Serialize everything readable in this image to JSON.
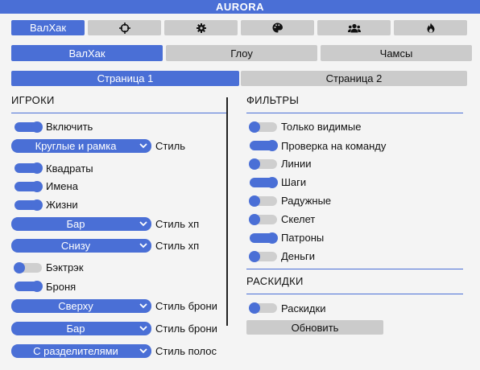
{
  "window": {
    "title": "AURORA"
  },
  "top_tabs": [
    {
      "label": "ВалХак",
      "active": true
    },
    {
      "icon": "crosshair-icon"
    },
    {
      "icon": "gear-icon"
    },
    {
      "icon": "palette-icon"
    },
    {
      "icon": "users-icon"
    },
    {
      "icon": "fire-icon"
    }
  ],
  "sub_tabs": [
    {
      "label": "ВалХак",
      "active": true
    },
    {
      "label": "Глоу",
      "active": false
    },
    {
      "label": "Чамсы",
      "active": false
    }
  ],
  "page_tabs": [
    {
      "label": "Страница 1",
      "active": true
    },
    {
      "label": "Страница 2",
      "active": false
    }
  ],
  "players": {
    "title": "ИГРОКИ",
    "enable": {
      "label": "Включить",
      "on": true
    },
    "style_dropdown": {
      "value": "Круглые и рамка",
      "label": "Стиль"
    },
    "squares": {
      "label": "Квадраты",
      "on": true
    },
    "names": {
      "label": "Имена",
      "on": true
    },
    "health": {
      "label": "Жизни",
      "on": true
    },
    "hp_style_1": {
      "value": "Бар",
      "label": "Стиль хп"
    },
    "hp_style_2": {
      "value": "Снизу",
      "label": "Стиль хп"
    },
    "backtrack": {
      "label": "Бэктрэк",
      "on": false
    },
    "armor": {
      "label": "Броня",
      "on": true
    },
    "armor_style_1": {
      "value": "Сверху",
      "label": "Стиль брони"
    },
    "armor_style_2": {
      "value": "Бар",
      "label": "Стиль брони"
    },
    "bar_style": {
      "value": "С разделителями",
      "label": "Стиль полос"
    }
  },
  "filters": {
    "title": "ФИЛЬТРЫ",
    "items": [
      {
        "label": "Только видимые",
        "on": false
      },
      {
        "label": "Проверка на команду",
        "on": true
      },
      {
        "label": "Линии",
        "on": false
      },
      {
        "label": "Шаги",
        "on": true
      },
      {
        "label": "Радужные",
        "on": false
      },
      {
        "label": "Скелет",
        "on": false
      },
      {
        "label": "Патроны",
        "on": true
      },
      {
        "label": "Деньги",
        "on": false
      }
    ]
  },
  "grenades": {
    "title": "РАСКИДКИ",
    "toggle": {
      "label": "Раскидки",
      "on": false
    },
    "refresh_label": "Обновить"
  },
  "colors": {
    "accent": "#4a6fd6",
    "inactive": "#cbcbcb",
    "background": "#f4f4f4"
  }
}
